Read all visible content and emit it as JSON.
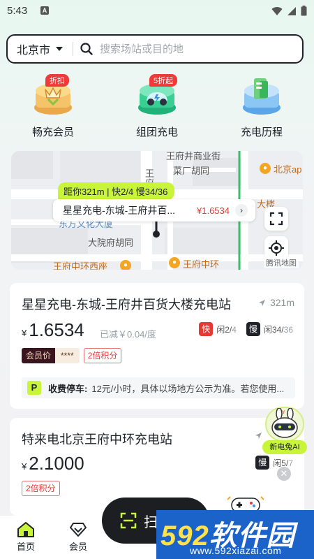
{
  "status_bar": {
    "time": "5:43"
  },
  "search": {
    "city": "北京市",
    "placeholder": "搜索场站或目的地"
  },
  "quick_actions": [
    {
      "label": "畅充会员",
      "badge": "折扣",
      "icon": "vip-member-icon"
    },
    {
      "label": "组团充电",
      "badge": "5折起",
      "icon": "group-charge-icon"
    },
    {
      "label": "充电历程",
      "badge": "",
      "icon": "charge-history-icon"
    }
  ],
  "map": {
    "pin_tag": "距你321m | 快2/4 慢34/36",
    "pin_station": "星星充电-东城-王府井百...",
    "pin_price": "¥1.6534",
    "labels": {
      "street1": "王府井商业街",
      "street2": "菜厂胡同",
      "street3": "大院府胡同",
      "street4": "王府中环西座",
      "street5": "王府中环",
      "poi1": "北京ap",
      "poi2": "大楼",
      "poi3": "东方文化大厦",
      "wang": "王",
      "fu": "府"
    },
    "attribution": "腾讯地图"
  },
  "stations": [
    {
      "name": "星星充电-东城-王府井百货大楼充电站",
      "distance": "321m",
      "currency": "¥",
      "price": "1.6534",
      "discount": "已减￥0.04/度",
      "fast_label": "快",
      "fast_free": "闲2/",
      "fast_total": "4",
      "slow_label": "慢",
      "slow_free": "闲34/",
      "slow_total": "36",
      "member_label": "会员价",
      "member_price": "****",
      "points": "2倍积分",
      "parking_label": "收费停车:",
      "parking_text": "12元/小时，具体以场地方公示为准。若您使用..."
    },
    {
      "name": "特来电北京王府中环充电站",
      "currency": "¥",
      "price": "2.1000",
      "slow_label": "慢",
      "slow_free": "闲5/",
      "slow_total": "7",
      "points": "2倍积分"
    }
  ],
  "ai_assistant": {
    "label": "新电兔AI"
  },
  "bottom_nav": {
    "home": "首页",
    "member": "会员",
    "scan": "扫"
  },
  "watermark": {
    "prefix": "",
    "number": "592",
    "title": "软件园",
    "url": "www.592xiazai.com"
  },
  "colors": {
    "accent_lime": "#c8f53a",
    "price_red": "#e53935",
    "dark": "#1f2329"
  }
}
